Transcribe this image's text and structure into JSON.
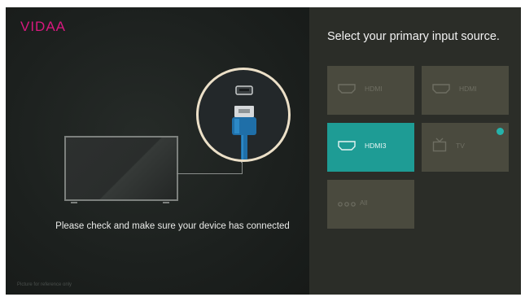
{
  "brand": {
    "logo_text": "VIDAA",
    "logo_color": "#d8187f"
  },
  "setup": {
    "message": "Please check and make sure your device has connected",
    "footnote": "Picture for reference only"
  },
  "input_source": {
    "title": "Select your primary input source.",
    "tiles": [
      {
        "label": "HDMI",
        "icon": "hdmi-port-icon",
        "state": "default"
      },
      {
        "label": "HDMI",
        "icon": "hdmi-port-icon",
        "state": "default"
      },
      {
        "label": "HDMI3",
        "icon": "hdmi-port-icon",
        "state": "focused"
      },
      {
        "label": "TV",
        "icon": "tv-antenna-icon",
        "state": "selected"
      },
      {
        "label": "All",
        "icon": "more-dots-icon",
        "state": "default"
      }
    ]
  },
  "colors": {
    "accent": "#1e9c95",
    "tile": "#4a4a3e",
    "check": "#25b3ab"
  }
}
